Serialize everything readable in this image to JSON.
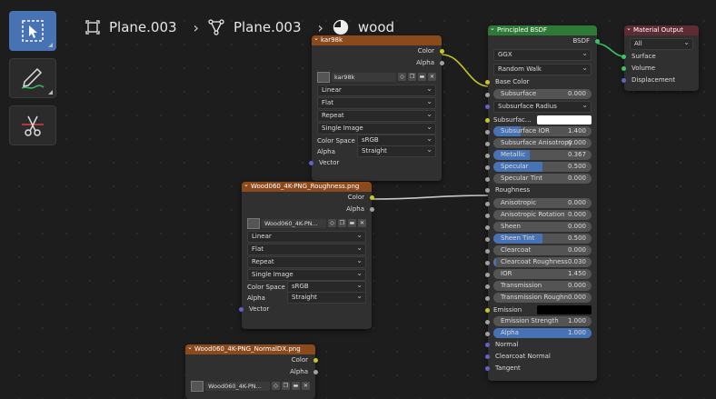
{
  "breadcrumb": [
    {
      "label": "Plane.003",
      "icon": "object-icon"
    },
    {
      "label": "Plane.003",
      "icon": "mesh-icon"
    },
    {
      "label": "wood",
      "icon": "material-icon"
    }
  ],
  "tools": [
    {
      "name": "select-box-tool",
      "active": true
    },
    {
      "name": "annotate-tool",
      "active": false
    },
    {
      "name": "links-cut-tool",
      "active": false
    }
  ],
  "node_kar": {
    "title": "kar98k",
    "outputs": [
      "Color",
      "Alpha"
    ],
    "image": "kar98k",
    "interpolation": "Linear",
    "projection": "Flat",
    "extension": "Repeat",
    "source": "Single Image",
    "color_space_label": "Color Space",
    "color_space": "sRGB",
    "alpha_label": "Alpha",
    "alpha": "Straight",
    "input": "Vector"
  },
  "node_rough": {
    "title": "Wood060_4K-PNG_Roughness.png",
    "outputs": [
      "Color",
      "Alpha"
    ],
    "image": "Wood060_4K-PN...",
    "interpolation": "Linear",
    "projection": "Flat",
    "extension": "Repeat",
    "source": "Single Image",
    "color_space_label": "Color Space",
    "color_space": "sRGB",
    "alpha_label": "Alpha",
    "alpha": "Straight",
    "input": "Vector"
  },
  "node_normal": {
    "title": "Wood060_4K-PNG_NormalDX.png",
    "outputs": [
      "Color",
      "Alpha"
    ],
    "image": "Wood060_4K-PN..."
  },
  "node_bsdf": {
    "title": "Principled BSDF",
    "output": "BSDF",
    "distribution": "GGX",
    "subsurface_method": "Random Walk",
    "base_color": "Base Color",
    "subsurface": {
      "label": "Subsurface",
      "value": "0.000",
      "frac": 0
    },
    "subsurface_radius": "Subsurface Radius",
    "subsurface_color": "Subsurfac...",
    "fields": [
      {
        "label": "Subsurface IOR",
        "value": "1.400",
        "frac": 0.28
      },
      {
        "label": "Subsurface Anisotropy",
        "value": "0.000",
        "frac": 0
      },
      {
        "label": "Metallic",
        "value": "0.367",
        "frac": 0.367
      },
      {
        "label": "Specular",
        "value": "0.500",
        "frac": 0.5
      },
      {
        "label": "Specular Tint",
        "value": "0.000",
        "frac": 0
      }
    ],
    "roughness": "Roughness",
    "fields2": [
      {
        "label": "Anisotropic",
        "value": "0.000",
        "frac": 0
      },
      {
        "label": "Anisotropic Rotation",
        "value": "0.000",
        "frac": 0
      },
      {
        "label": "Sheen",
        "value": "0.000",
        "frac": 0
      },
      {
        "label": "Sheen Tint",
        "value": "0.500",
        "frac": 0.5
      },
      {
        "label": "Clearcoat",
        "value": "0.000",
        "frac": 0
      },
      {
        "label": "Clearcoat Roughness",
        "value": "0.030",
        "frac": 0.03
      },
      {
        "label": "IOR",
        "value": "1.450",
        "frac": 0
      },
      {
        "label": "Transmission",
        "value": "0.000",
        "frac": 0
      },
      {
        "label": "Transmission Roughn",
        "value": "0.000",
        "frac": 0
      }
    ],
    "emission": "Emission",
    "emission_strength": {
      "label": "Emission Strength",
      "value": "1.000",
      "frac": 0
    },
    "alpha": {
      "label": "Alpha",
      "value": "1.000",
      "frac": 1
    },
    "inputs_tail": [
      "Normal",
      "Clearcoat Normal",
      "Tangent"
    ]
  },
  "node_output": {
    "title": "Material Output",
    "target": "All",
    "inputs": [
      "Surface",
      "Volume",
      "Displacement"
    ]
  },
  "colors": {
    "accent": "#4772b3",
    "texture_header": "#8b4a1c",
    "shader_header": "#2d7a37",
    "output_header": "#5e2b34"
  }
}
